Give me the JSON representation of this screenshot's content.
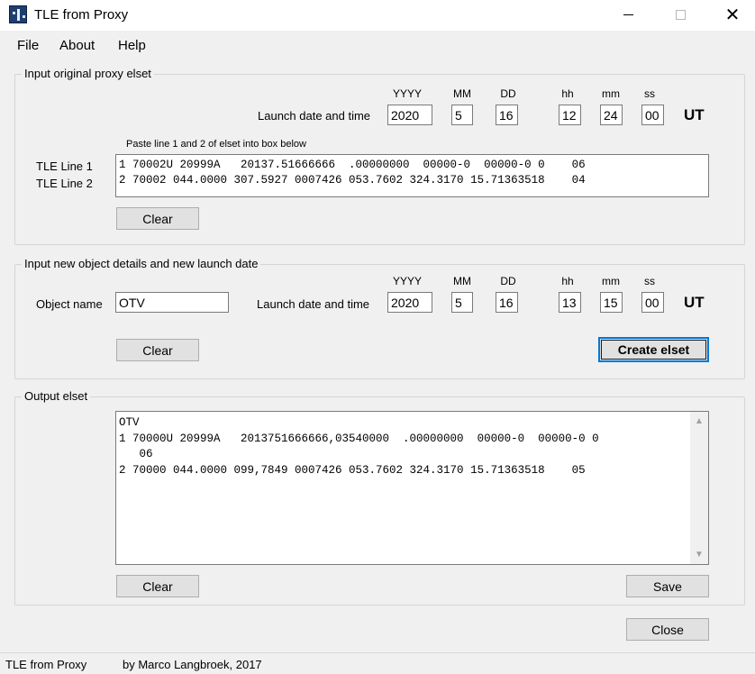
{
  "window": {
    "title": "TLE from Proxy",
    "controls": {
      "minimize_icon": "minimize-icon",
      "maximize_icon": "maximize-icon",
      "close_icon": "close-icon",
      "close_glyph": "✕"
    }
  },
  "menu": {
    "items": [
      "File",
      "About",
      "Help"
    ]
  },
  "columns": {
    "year": "YYYY",
    "month": "MM",
    "day": "DD",
    "hour": "hh",
    "minute": "mm",
    "second": "ss"
  },
  "proxy": {
    "group_title": "Input original proxy elset",
    "launch_label": "Launch date and time",
    "date": {
      "year": "2020",
      "month": "5",
      "day": "16",
      "hour": "12",
      "minute": "24",
      "second": "00"
    },
    "ut": "UT",
    "paste_hint": "Paste line 1 and 2 of elset into box below",
    "tle_line1_label": "TLE Line 1",
    "tle_line2_label": "TLE Line 2",
    "tle_text": "1 70002U 20999A   20137.51666666  .00000000  00000-0  00000-0 0    06\n2 70002 044.0000 307.5927 0007426 053.7602 324.3170 15.71363518    04",
    "clear_label": "Clear"
  },
  "new_object": {
    "group_title": "Input new object details and new launch date",
    "object_name_label": "Object name",
    "object_name": "OTV",
    "launch_label": "Launch date and time",
    "date": {
      "year": "2020",
      "month": "5",
      "day": "16",
      "hour": "13",
      "minute": "15",
      "second": "00"
    },
    "ut": "UT",
    "clear_label": "Clear",
    "create_label": "Create elset"
  },
  "output": {
    "group_title": "Output elset",
    "text": "OTV\n1 70000U 20999A   2013751666666,03540000  .00000000  00000-0  00000-0 0\n   06\n2 70000 044.0000 099,7849 0007426 053.7602 324.3170 15.71363518    05",
    "clear_label": "Clear",
    "save_label": "Save"
  },
  "close_label": "Close",
  "status": {
    "app_name": "TLE from Proxy",
    "credit": "by Marco Langbroek, 2017"
  }
}
